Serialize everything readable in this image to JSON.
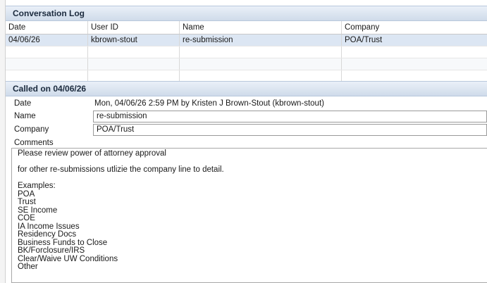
{
  "log": {
    "title": "Conversation Log",
    "columns": [
      "Date",
      "User ID",
      "Name",
      "Company"
    ],
    "rows": [
      [
        "04/06/26",
        "kbrown-stout",
        "re-submission",
        "POA/Trust"
      ]
    ]
  },
  "detail": {
    "title": "Called on 04/06/26",
    "date_label": "Date",
    "date_value": "Mon, 04/06/26 2:59 PM by Kristen  J Brown-Stout (kbrown-stout)",
    "name_label": "Name",
    "name_value": "re-submission",
    "company_label": "Company",
    "company_value": "POA/Trust",
    "comments_label": "Comments",
    "comments_lines": [
      "Please review power of attorney approval",
      "",
      "for other re-submissions utlizie the company line to detail.",
      "",
      "Examples:",
      "POA",
      "Trust",
      "SE Income",
      "COE",
      "IA Income Issues",
      "Residency Docs",
      "Business Funds to Close",
      "BK/Forclosure/IRS",
      "Clear/Waive UW Conditions",
      "Other"
    ]
  }
}
